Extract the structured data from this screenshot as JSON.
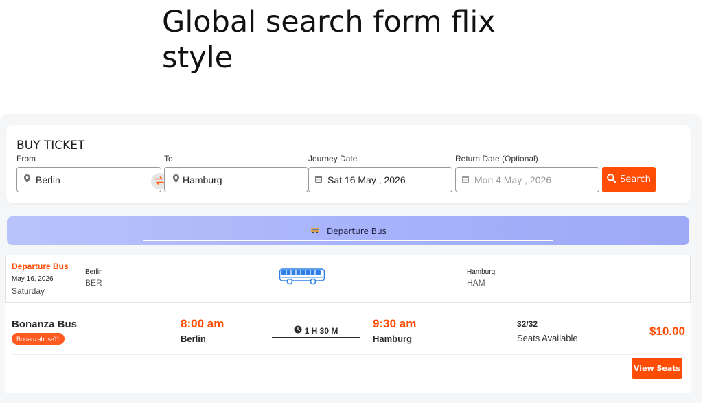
{
  "page": {
    "title": "Global search form flix style"
  },
  "search": {
    "heading": "BUY TICKET",
    "from_label": "From",
    "from_value": "Berlin",
    "to_label": "To",
    "to_value": "Hamburg",
    "journey_label": "Journey Date",
    "journey_value": "Sat 16 May , 2026",
    "return_label": "Return Date (Optional)",
    "return_placeholder": "Mon 4 May , 2026",
    "search_label": "Search"
  },
  "tabs": {
    "departure_label": "Departure Bus"
  },
  "route": {
    "title": "Departure Bus",
    "date": "May 16, 2026",
    "day": "Saturday",
    "from_city": "Berlin",
    "from_code": "BER",
    "to_city": "Hamburg",
    "to_code": "HAM"
  },
  "trip": {
    "operator": "Bonanza Bus",
    "badge": "Bonanzabus-01",
    "departure_time": "8:00 am",
    "departure_city": "Berlin",
    "duration": "1 H 30 M",
    "arrival_time": "9:30 am",
    "arrival_city": "Hamburg",
    "seats_count": "32/32",
    "seats_label": "Seats Available",
    "price": "$10.00",
    "view_seats_label": "View Seats"
  },
  "icons": {
    "location": "map-pin-icon",
    "swap": "swap-arrows-icon",
    "calendar": "calendar-icon",
    "search": "magnifier-icon",
    "bus": "bus-icon",
    "clock": "clock-icon"
  },
  "colors": {
    "accent": "#ff4d05",
    "banner": "#a6b2fa"
  }
}
